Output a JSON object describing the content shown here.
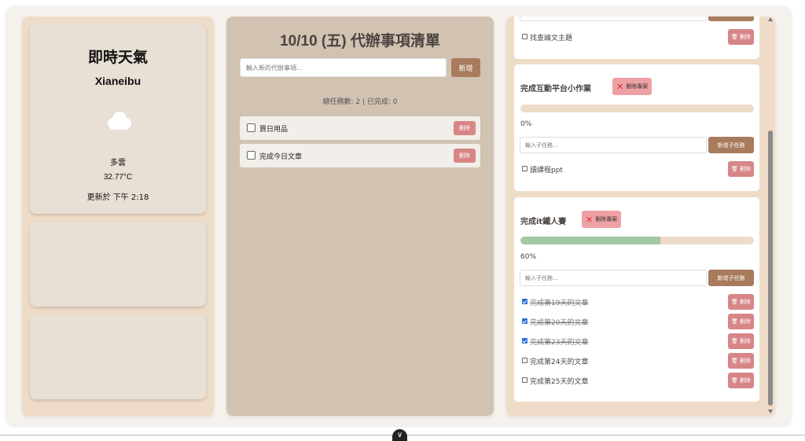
{
  "weather": {
    "title": "即時天氣",
    "city": "Xianeibu",
    "icon": "cloud-icon",
    "condition": "多雲",
    "temperature": "32.77°C",
    "updated": "更新於 下午 2:18"
  },
  "todo": {
    "title": "10/10 (五) 代辦事項清單",
    "input_placeholder": "輸入新的代辦事項...",
    "add_label": "新增",
    "stats": "總任務數: 2 | 已完成: 0",
    "items": [
      {
        "label": "買日用品",
        "delete_label": "刪除",
        "checked": false
      },
      {
        "label": "完成今日文章",
        "delete_label": "刪除",
        "checked": false
      }
    ]
  },
  "projects": [
    {
      "title": "",
      "subtasks": [
        {
          "label": "找查論文主題",
          "done": false,
          "delete_label": "🗑 刪除"
        }
      ]
    },
    {
      "title": "完成互動平台小作業",
      "delete_label": "刪除專案",
      "progress": 0,
      "progress_text": "0%",
      "input_placeholder": "輸入子任務...",
      "add_label": "新增子任務",
      "subtasks": [
        {
          "label": "讀課程ppt",
          "done": false,
          "delete_label": "🗑 刪除"
        }
      ]
    },
    {
      "title": "完成it鐵人賽",
      "delete_label": "刪除專案",
      "progress": 60,
      "progress_text": "60%",
      "input_placeholder": "輸入子任務...",
      "add_label": "新增子任務",
      "subtasks": [
        {
          "label": "完成第19天的文章",
          "done": true,
          "delete_label": "🗑 刪除"
        },
        {
          "label": "完成第20天的文章",
          "done": true,
          "delete_label": "🗑 刪除"
        },
        {
          "label": "完成第23天的文章",
          "done": true,
          "delete_label": "🗑 刪除"
        },
        {
          "label": "完成第24天的文章",
          "done": false,
          "delete_label": "🗑 刪除"
        },
        {
          "label": "完成第25天的文章",
          "done": false,
          "delete_label": "🗑 刪除"
        }
      ]
    }
  ],
  "colors": {
    "accent_brown": "#a87b5c",
    "delete_red": "#d78687",
    "progress_green": "#a3c8a3",
    "progress_track": "#ecdcc8"
  },
  "bottom_button_glyph": "∨"
}
